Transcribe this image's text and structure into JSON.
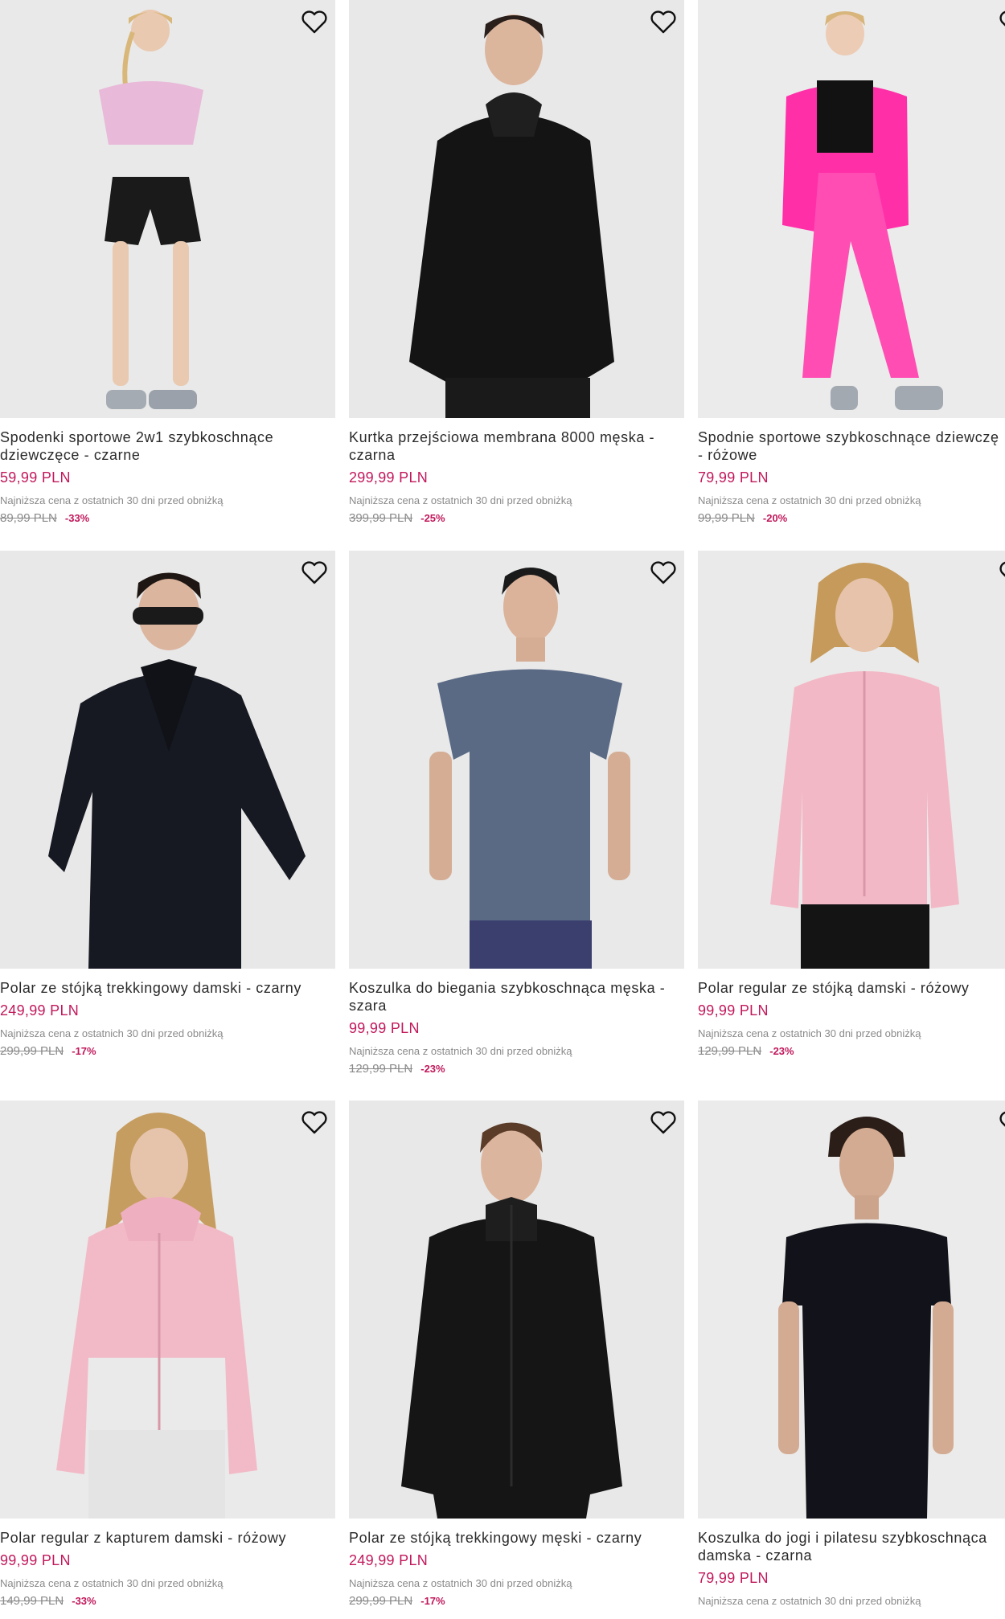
{
  "products": [
    {
      "title": "Spodenki sportowe 2w1 szybkoschnące\ndziewczęce - czarne",
      "price": "59,99 PLN",
      "lowest_label": "Najniższa cena z ostatnich 30 dni przed obniżką",
      "old_price": "89,99 PLN",
      "discount": "-33%",
      "image": "girl-shorts",
      "colors": {
        "top": "#e6b7d6",
        "bottom": "#1a1a1a"
      }
    },
    {
      "title": "Kurtka przejściowa membrana 8000 męska -\nczarna",
      "price": "299,99 PLN",
      "lowest_label": "Najniższa cena z ostatnich 30 dni przed obniżką",
      "old_price": "399,99 PLN",
      "discount": "-25%",
      "image": "man-jacket",
      "colors": {
        "top": "#141414",
        "bottom": "#1a1a1a"
      }
    },
    {
      "title": "Spodnie sportowe szybkoschnące dziewczę\n- różowe",
      "price": "79,99 PLN",
      "lowest_label": "Najniższa cena z ostatnich 30 dni przed obniżką",
      "old_price": "99,99 PLN",
      "discount": "-20%",
      "image": "girl-pink-tracksuit",
      "colors": {
        "top": "#ff2fa8",
        "bottom": "#ff4db3"
      }
    },
    {
      "title": "Polar ze stójką trekkingowy damski - czarny",
      "price": "249,99 PLN",
      "lowest_label": "Najniższa cena z ostatnich 30 dni przed obniżką",
      "old_price": "299,99 PLN",
      "discount": "-17%",
      "image": "woman-black-fleece",
      "colors": {
        "top": "#161820",
        "bottom": "#13151c"
      }
    },
    {
      "title": "Koszulka do biegania szybkoschnąca męska -\nszara",
      "price": "99,99 PLN",
      "lowest_label": "Najniższa cena z ostatnich 30 dni przed obniżką",
      "old_price": "129,99 PLN",
      "discount": "-23%",
      "image": "man-grey-tee",
      "colors": {
        "top": "#5a6a85",
        "bottom": "#3b3f6e"
      }
    },
    {
      "title": "Polar regular ze stójką damski - różowy",
      "price": "99,99 PLN",
      "lowest_label": "Najniższa cena z ostatnich 30 dni przed obniżką",
      "old_price": "129,99 PLN",
      "discount": "-23%",
      "image": "woman-pink-fleece",
      "colors": {
        "top": "#f3b8c6",
        "bottom": "#141414"
      }
    },
    {
      "title": "Polar regular z kapturem damski - różowy",
      "price": "99,99 PLN",
      "lowest_label": "Najniższa cena z ostatnich 30 dni przed obniżką",
      "old_price": "149,99 PLN",
      "discount": "-33%",
      "image": "woman-pink-hoodie",
      "colors": {
        "top": "#f2bac7",
        "bottom": "#e4e4e4"
      }
    },
    {
      "title": "Polar ze stójką trekkingowy męski - czarny",
      "price": "249,99 PLN",
      "lowest_label": "Najniższa cena z ostatnich 30 dni przed obniżką",
      "old_price": "299,99 PLN",
      "discount": "-17%",
      "image": "man-black-fleece",
      "colors": {
        "top": "#151515",
        "bottom": "#161616"
      }
    },
    {
      "title": "Koszulka do jogi i pilatesu szybkoschnąca\ndamska - czarna",
      "price": "79,99 PLN",
      "lowest_label": "Najniższa cena z ostatnich 30 dni przed obniżką",
      "old_price": "",
      "discount": "",
      "image": "woman-black-tee",
      "colors": {
        "top": "#12131a",
        "bottom": "#12131a"
      }
    }
  ],
  "accent_color": "#c2185b"
}
